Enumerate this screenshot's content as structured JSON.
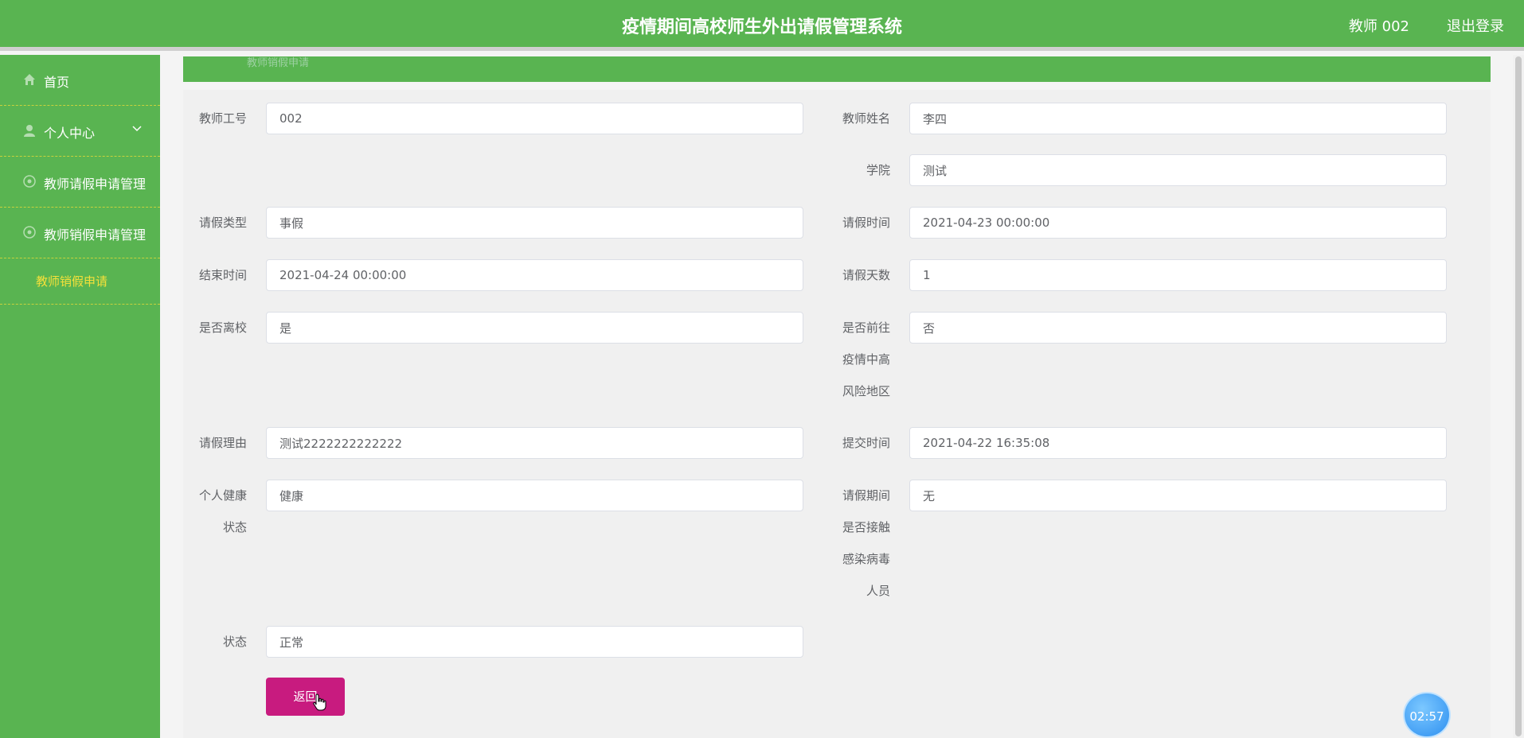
{
  "header": {
    "title": "疫情期间高校师生外出请假管理系统",
    "user": "教师 002",
    "logout": "退出登录"
  },
  "sidebar": {
    "items": [
      {
        "label": "首页",
        "icon": "home-icon"
      },
      {
        "label": "个人中心",
        "icon": "user-icon"
      },
      {
        "label": "教师请假申请管理",
        "icon": "settings-icon"
      },
      {
        "label": "教师销假申请管理",
        "icon": "settings-icon"
      }
    ],
    "sub_item": "教师销假申请"
  },
  "breadcrumb": "教师销假申请",
  "form": {
    "teacher_id": {
      "label": "教师工号",
      "value": "002"
    },
    "teacher_name": {
      "label": "教师姓名",
      "value": "李四"
    },
    "college": {
      "label": "学院",
      "value": "测试"
    },
    "leave_type": {
      "label": "请假类型",
      "value": "事假"
    },
    "leave_time": {
      "label": "请假时间",
      "value": "2021-04-23 00:00:00"
    },
    "end_time": {
      "label": "结束时间",
      "value": "2021-04-24 00:00:00"
    },
    "leave_days": {
      "label": "请假天数",
      "value": "1"
    },
    "left_school": {
      "label": "是否离校",
      "value": "是"
    },
    "high_risk_area": {
      "label_lines": [
        "是否前往",
        "疫情中高",
        "风险地区"
      ],
      "value": "否"
    },
    "reason": {
      "label": "请假理由",
      "value": "测试2222222222222"
    },
    "submit_time": {
      "label": "提交时间",
      "value": "2021-04-22 16:35:08"
    },
    "health": {
      "label_lines": [
        "个人健康",
        "状态"
      ],
      "value": "健康"
    },
    "contact": {
      "label_lines": [
        "请假期间",
        "是否接触",
        "感染病毒",
        "人员"
      ],
      "value": "无"
    },
    "status": {
      "label": "状态",
      "value": "正常"
    }
  },
  "back_button": "返回",
  "timer": "02:57",
  "colors": {
    "primary": "#59b451",
    "accent": "#c81b7f",
    "submenu_text": "#f4e03a"
  }
}
